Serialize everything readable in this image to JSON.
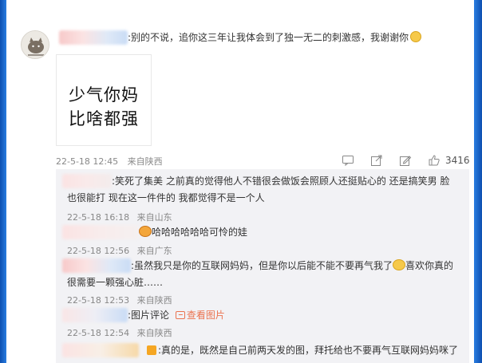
{
  "comment": {
    "text": ":别的不说，追你这三年让我体会到了独一无二的刺激感，我谢谢你",
    "image_line1": "少气你妈",
    "image_line2": "比啥都强",
    "date": "22-5-18 12:45",
    "source": "来自陕西",
    "like_count": "3416"
  },
  "replies": [
    {
      "text_line1": ":笑死了集美  之前真的觉得他人不错很会做饭会照顾人还挺贴心的  还是搞笑男  脸",
      "text_line2": "也很能打  现在这一件件的  我都觉得不是一个人",
      "date": "22-5-18 16:18",
      "source": "来自山东"
    },
    {
      "text_line1": "哈哈哈哈哈哈可怜的娃",
      "date": "22-5-18 12:56",
      "source": "来自广东"
    },
    {
      "text_line1": ":虽然我只是你的互联网妈妈，但是你以后能不能不要再气我了",
      "text_line1b": "喜欢你真的",
      "text_line2": "很需要一颗强心脏……",
      "date": "22-5-18 12:53",
      "source": "来自陕西"
    },
    {
      "text_line1": ":图片评论",
      "link": "查看图片",
      "date": "22-5-18 12:54",
      "source": "来自陕西"
    },
    {
      "text_line1": ":真的是，既然是自己前两天发的图，拜托给也不要再气互联网妈妈咪了"
    }
  ],
  "icons": [
    "smile-emoji-icon",
    "comment-icon",
    "share-icon",
    "edit-icon",
    "like-icon",
    "sad-emoji-icon",
    "cry-emoji-icon",
    "picture-icon"
  ],
  "colors": {
    "page_bg": "#1f6fd1",
    "reply_bg": "#f2f2f5",
    "link": "#eb7350",
    "meta": "#888888"
  }
}
